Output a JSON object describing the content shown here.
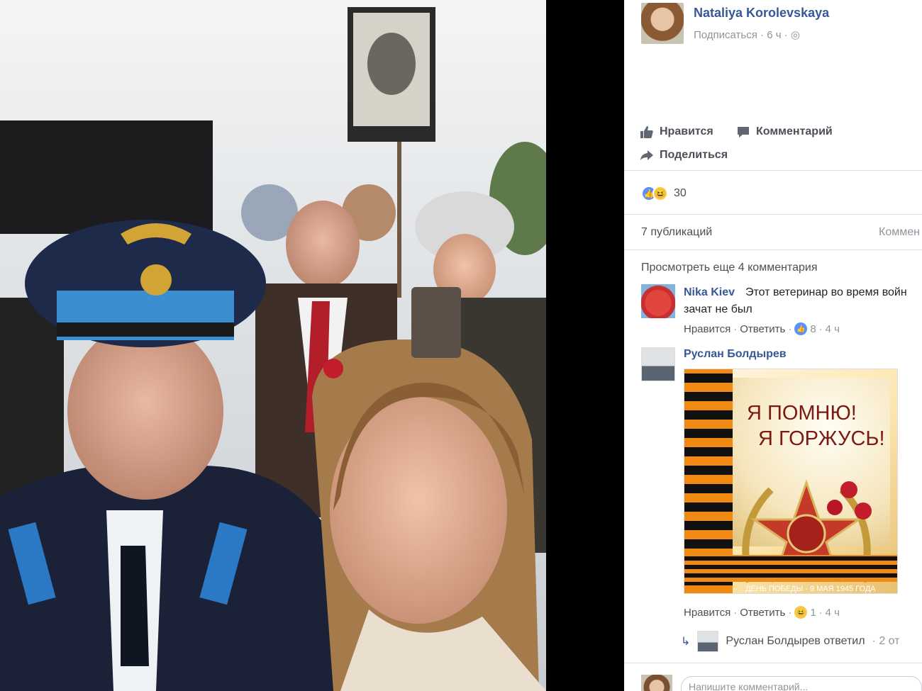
{
  "post": {
    "author": "Nataliya Korolevskaya",
    "follow": "Подписаться",
    "time": "6 ч"
  },
  "actions": {
    "like": "Нравится",
    "comment": "Комментарий",
    "share": "Поделиться"
  },
  "reactions": {
    "count": "30"
  },
  "stats": {
    "shares": "7 публикаций",
    "comments_partial": "Коммен"
  },
  "view_more": "Просмотреть еще 4 комментария",
  "comments": [
    {
      "author": "Nika Kiev",
      "text_line1": "Этот ветеринар во время войн",
      "text_line2": "зачат не был",
      "like": "Нравится",
      "reply": "Ответить",
      "reaction_count": "8",
      "time": "4 ч"
    },
    {
      "author": "Руслан Болдырев",
      "image_text_line1": "Я ПОМНЮ!",
      "image_text_line2": "Я ГОРЖУСЬ!",
      "image_footer": "ДЕНЬ ПОБЕДЫ - 9 МАЯ 1945 ГОДА",
      "like": "Нравится",
      "reply": "Ответить",
      "reaction_count": "1",
      "time": "4 ч"
    }
  ],
  "reply_summary": {
    "text": "Руслан Болдырев ответил",
    "extra": "· 2 от"
  },
  "comment_input": {
    "placeholder": "Напишите комментарий..."
  },
  "colors": {
    "link_blue": "#365899",
    "secondary_gray": "#90949c",
    "like_blue": "#5890ff"
  }
}
